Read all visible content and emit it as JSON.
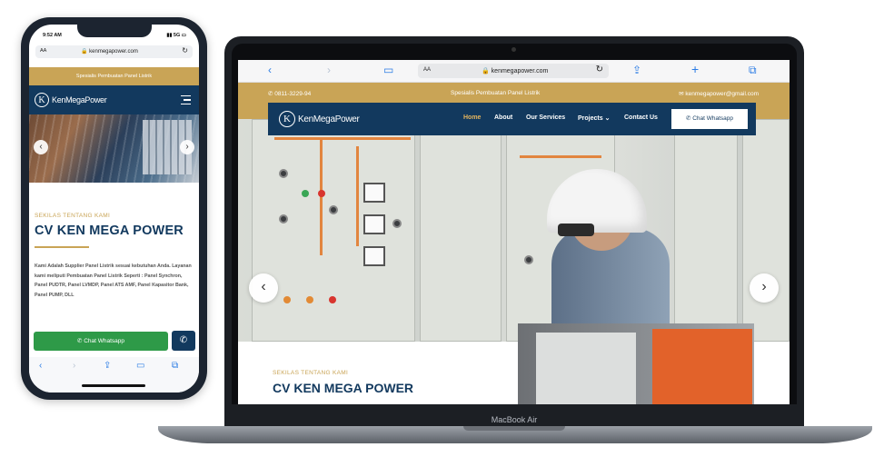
{
  "phone": {
    "status_time": "9:52 AM",
    "status_right": "▮▮ 5G ▭",
    "url_aa": "AA",
    "url": "kenmegapower.com",
    "tagline": "Spesialis Pembuatan Panel Listrik",
    "logo_text": "KenMegaPower",
    "subheading": "SEKILAS TENTANG KAMI",
    "title": "CV KEN MEGA POWER",
    "description": "Kami Adalah Supplier Panel Listrik sesuai kebutuhan Anda. Layanan kami meliputi Pembuatan Panel Listrik Seperti : Panel Synchron, Panel PUDTR, Panel LVMDP, Panel ATS AMF, Panel Kapasitor Bank, Panel PUMP, DLL",
    "whatsapp_label": "Chat Whatsapp"
  },
  "laptop": {
    "url_aa": "AA",
    "url": "kenmegapower.com",
    "phone_number": "0811-3229-94",
    "tagline": "Spesialis Pembuatan Panel Listrik",
    "email": "kenmegapower@gmail.com",
    "logo_text": "KenMegaPower",
    "nav": {
      "home": "Home",
      "about": "About",
      "services": "Our Services",
      "projects": "Projects ⌄",
      "contact": "Contact Us"
    },
    "whatsapp_label": "Chat Whatsapp",
    "subheading": "SEKILAS TENTANG KAMI",
    "title": "CV KEN MEGA POWER",
    "brand": "MacBook Air"
  },
  "icons": {
    "lock": "🔒",
    "reload": "↻",
    "back": "‹",
    "forward": "›",
    "share": "⇪",
    "book": "▭",
    "tabs": "⧉",
    "plus": "+",
    "whatsapp": "✆",
    "phone": "✆",
    "mail": "✉"
  },
  "colors": {
    "navy": "#12395e",
    "gold": "#c9a456",
    "green": "#2e9a48"
  }
}
